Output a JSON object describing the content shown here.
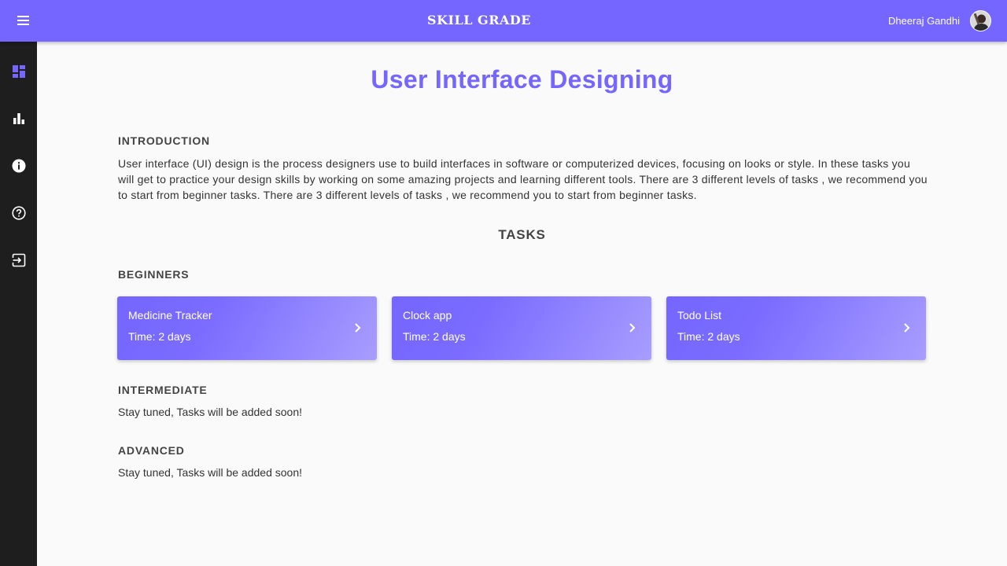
{
  "header": {
    "brand": "SKILL GRADE",
    "user_name": "Dheeraj Gandhi"
  },
  "sidebar": {
    "items": [
      {
        "icon": "dashboard-icon",
        "active": true
      },
      {
        "icon": "bar-chart-icon",
        "active": false
      },
      {
        "icon": "info-icon",
        "active": false
      },
      {
        "icon": "help-icon",
        "active": false
      },
      {
        "icon": "logout-icon",
        "active": false
      }
    ]
  },
  "main": {
    "title": "User Interface Designing",
    "intro_heading": "INTRODUCTION",
    "intro_text": "User interface (UI) design is the process designers use to build interfaces in software or computerized devices, focusing on looks or style. In these tasks you will get to practice your design skills by working on some amazing projects and learning different tools. There are 3 different levels of tasks , we recommend you to start from beginner tasks. There are 3 different levels of tasks , we recommend you to start from beginner tasks.",
    "tasks_heading": "TASKS",
    "beginners": {
      "heading": "BEGINNERS",
      "cards": [
        {
          "title": "Medicine Tracker",
          "time": "Time: 2 days"
        },
        {
          "title": "Clock app",
          "time": "Time: 2 days"
        },
        {
          "title": "Todo List",
          "time": "Time: 2 days"
        }
      ]
    },
    "intermediate": {
      "heading": "INTERMEDIATE",
      "message": "Stay tuned, Tasks will be added soon!"
    },
    "advanced": {
      "heading": "ADVANCED",
      "message": "Stay tuned, Tasks will be added soon!"
    }
  },
  "colors": {
    "accent": "#7466ff",
    "sidebar_bg": "#1e1e1e",
    "page_bg": "#fafafa"
  }
}
